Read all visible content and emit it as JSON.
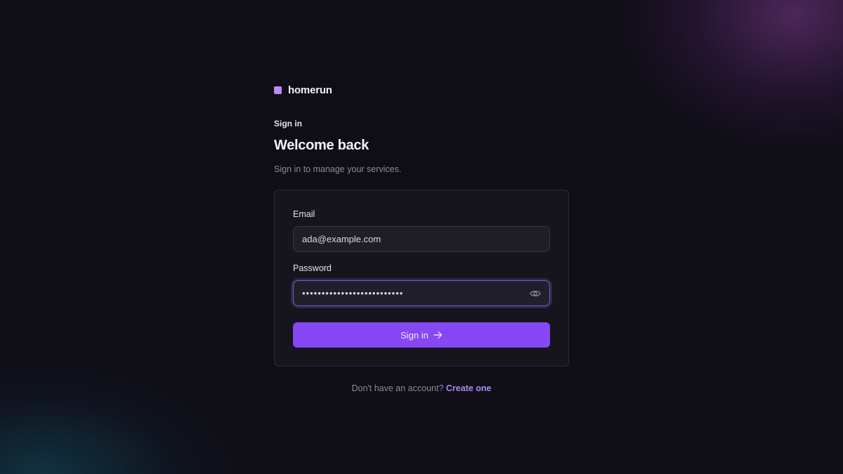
{
  "colors": {
    "background": "#0f0d16",
    "brand_mark": "#b98cf5",
    "accent": "#8647f5",
    "link": "#a98bf0"
  },
  "brand": {
    "icon": "square-logo-icon",
    "name": "homerun"
  },
  "header": {
    "eyebrow": "Sign in",
    "title": "Welcome back",
    "subtitle": "Sign in to manage your services."
  },
  "form": {
    "email": {
      "label": "Email",
      "value": "ada@example.com"
    },
    "password": {
      "label": "Password",
      "value": "••••••••••••••••••••••••••",
      "toggle_icon": "eye-icon"
    },
    "submit": {
      "label": "Sign in",
      "icon": "arrow-right-icon"
    }
  },
  "footer": {
    "prompt": "Don't have an account?",
    "link": "Create one"
  }
}
